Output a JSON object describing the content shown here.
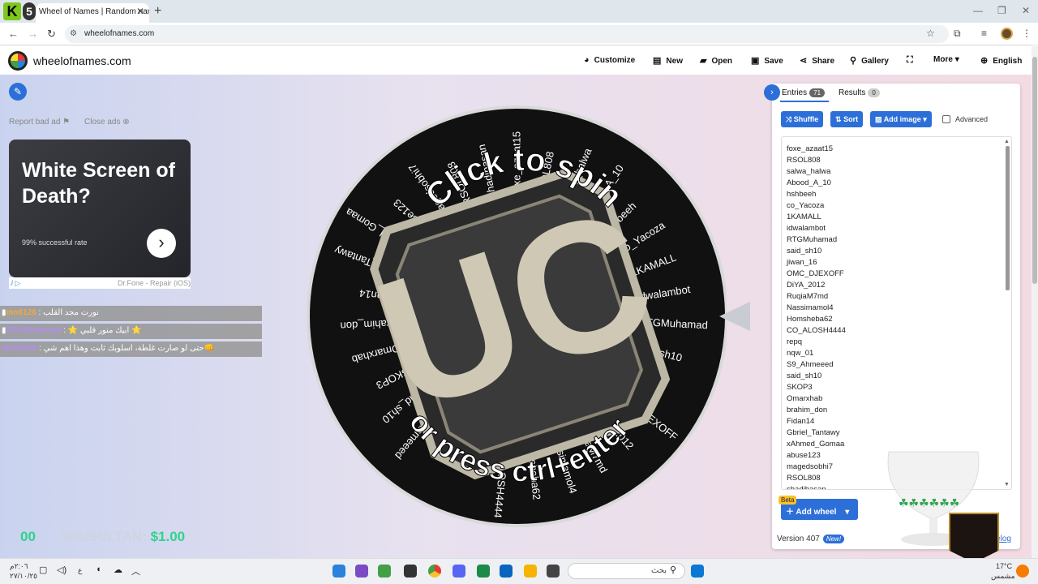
{
  "browser": {
    "tab_title": "Wheel of Names | Random nam",
    "tab_close": "✕",
    "new_tab": "+",
    "url": "wheelofnames.com",
    "logo_letter": "K",
    "logo_number": "5"
  },
  "site": {
    "name": "wheelofnames.com",
    "menu": [
      {
        "icon": "palette-icon",
        "label": "Customize"
      },
      {
        "icon": "file-icon",
        "label": "New"
      },
      {
        "icon": "folder-open-icon",
        "label": "Open"
      },
      {
        "icon": "save-icon",
        "label": "Save"
      },
      {
        "icon": "share-icon",
        "label": "Share"
      },
      {
        "icon": "search-icon",
        "label": "Gallery"
      },
      {
        "icon": "fullscreen-icon",
        "label": ""
      },
      {
        "icon": "chevron-down-icon",
        "label": "More"
      },
      {
        "icon": "globe-icon",
        "label": "English"
      }
    ]
  },
  "ad": {
    "report": "Report bad ad",
    "close": "Close ads",
    "title": "White Screen of Death?",
    "subtitle": "99% successful rate",
    "advertiser": "Dr.Fone - Repair (iOS)"
  },
  "chat": [
    {
      "name": "mo6126",
      "message": "نورت مجد القلب"
    },
    {
      "name": "RTGMuhamad",
      "message": "⭐ ابيك منور قلبي ⭐"
    },
    {
      "name": "ahmd929",
      "message": "حتى لو صارت غلطة، اسلوبك ثابت وهذا اهم شي👊"
    }
  ],
  "stats": {
    "left": "00",
    "name": "ABUSULTAN:",
    "amount": "$1.00"
  },
  "wheel": {
    "line1": "Click to spin",
    "line2": "or press ctrl+enter",
    "center_logo": "UC",
    "colors": {
      "bg": "#111111",
      "text": "#ffffff",
      "ring": "#d9d9d9",
      "logo": "#cfc8b4"
    }
  },
  "panel": {
    "tab_entries": "Entries",
    "entries_count": "71",
    "tab_results": "Results",
    "results_count": "0",
    "shuffle": "Shuffle",
    "sort": "Sort",
    "add_image": "Add image",
    "advanced": "Advanced",
    "entries": [
      "foxe_azaat15",
      "RSOL808",
      "salwa_halwa",
      "Abood_A_10",
      "hshbeeh",
      "co_Yacoza",
      "1KAMALL",
      "idwalambot",
      "RTGMuhamad",
      "said_sh10",
      "jiwan_16",
      "OMC_DJEXOFF",
      "DiYA_2012",
      "RuqiaM7md",
      "Nassimamol4",
      "Homsheba62",
      "CO_ALOSH4444",
      "repq",
      "nqw_01",
      "S9_Ahmeeed",
      "said_sh10",
      "SKOP3",
      "Omarxhab",
      "brahim_don",
      "Fidan14",
      "Gbriel_Tantawy",
      "xAhmed_Gomaa",
      "abuse123",
      "magedsobhi7",
      "RSOL808",
      "shadihasan"
    ],
    "beta": "Beta",
    "add_wheel": "Add wheel",
    "version": "Version 407",
    "new_badge": "New!",
    "changelog": "elog"
  },
  "taskbar": {
    "time": "٢:٠٦م",
    "date": "٢٧/١٠/٢٥",
    "lang": "ع",
    "search_placeholder": "بحث",
    "temperature": "17°C",
    "weather": "مشمس"
  }
}
